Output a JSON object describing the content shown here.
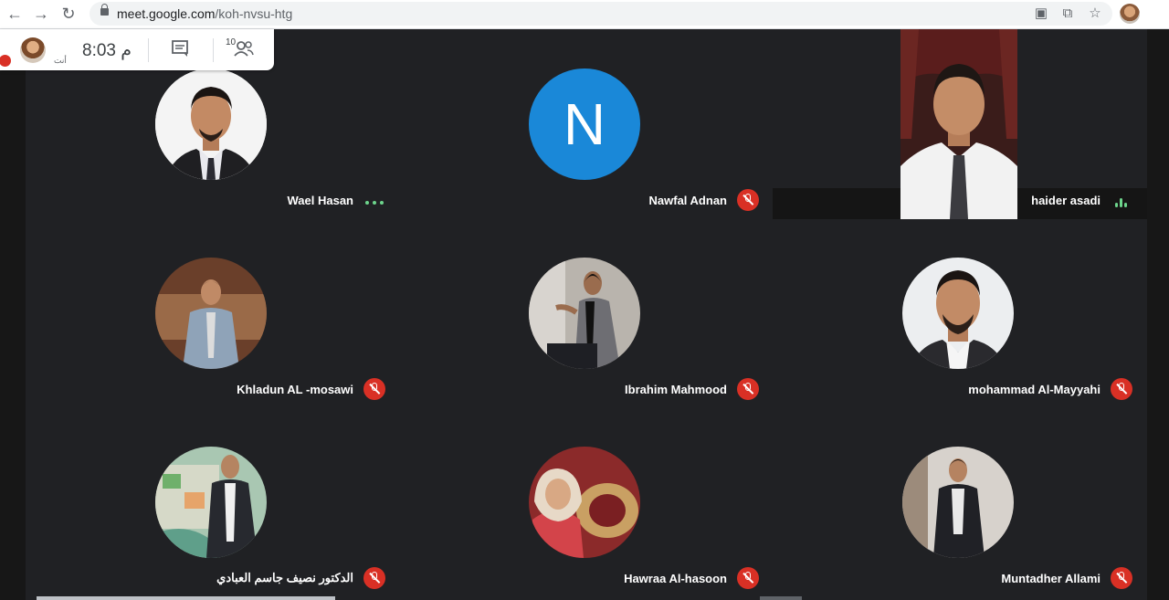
{
  "browser": {
    "url_host": "meet.google.com",
    "url_path": "/koh-nvsu-htg"
  },
  "panel": {
    "you_label": "أنت",
    "clock": "8:03 م",
    "participant_count": "10"
  },
  "participants": [
    {
      "name": "Wael Hasan",
      "status": "speaking-dots"
    },
    {
      "name": "Nawfal Adnan",
      "status": "muted",
      "initial": "N"
    },
    {
      "name": "haider asadi",
      "status": "speaking"
    },
    {
      "name": "Khladun AL -mosawi",
      "status": "muted"
    },
    {
      "name": "Ibrahim Mahmood",
      "status": "muted"
    },
    {
      "name": "mohammad Al-Mayyahi",
      "status": "muted"
    },
    {
      "name": "الدكتور نصيف جاسم العبادي",
      "status": "muted"
    },
    {
      "name": "Hawraa Al-hasoon",
      "status": "muted"
    },
    {
      "name": "Muntadher Allami",
      "status": "muted"
    }
  ],
  "colors": {
    "background": "#202124",
    "mute_red": "#d93025",
    "speaking_green": "#6dd58c",
    "initial_avatar_blue": "#1a88d8"
  }
}
